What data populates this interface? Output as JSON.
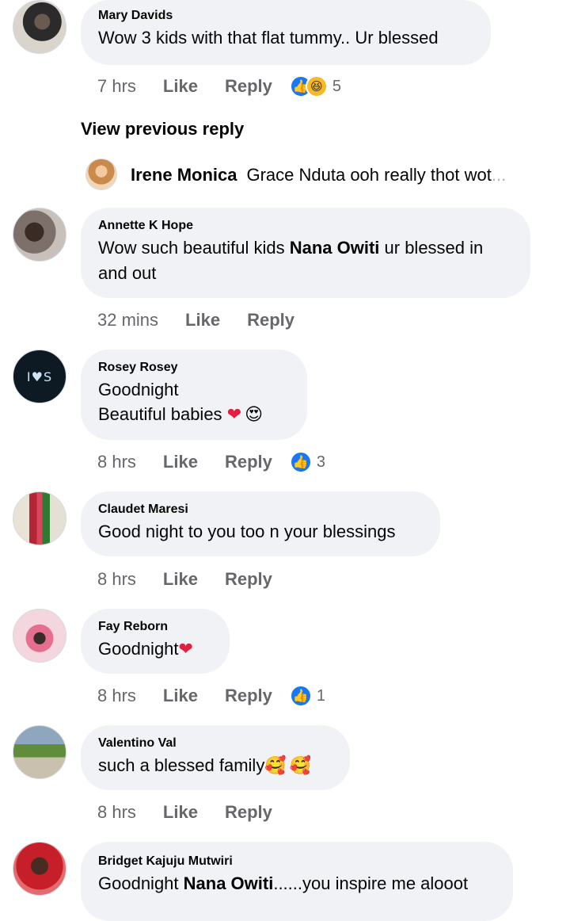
{
  "comments": [
    {
      "name": "Mary Davids",
      "text": "Wow 3 kids with that flat tummy.. Ur blessed",
      "time": "7 hrs",
      "like": "Like",
      "reply": "Reply",
      "reaction_count": "5",
      "reactions": [
        "like-icon",
        "haha-icon"
      ]
    },
    {
      "name": "Annette K Hope",
      "text_before": "Wow such beautiful kids ",
      "mention": "Nana Owiti",
      "text_after": " ur blessed in and out",
      "time": "32 mins",
      "like": "Like",
      "reply": "Reply"
    },
    {
      "name": "Rosey Rosey",
      "line1": "Goodnight",
      "line2": "Beautiful babies",
      "time": "8 hrs",
      "like": "Like",
      "reply": "Reply",
      "reaction_count": "3",
      "reactions": [
        "like-icon"
      ]
    },
    {
      "name": "Claudet Maresi",
      "text": "Good night to you too n your blessings",
      "time": "8 hrs",
      "like": "Like",
      "reply": "Reply"
    },
    {
      "name": "Fay Reborn",
      "text": "Goodnight",
      "time": "8 hrs",
      "like": "Like",
      "reply": "Reply",
      "reaction_count": "1",
      "reactions": [
        "like-icon"
      ]
    },
    {
      "name": "Valentino Val",
      "text": "such a blessed family",
      "time": "8 hrs",
      "like": "Like",
      "reply": "Reply"
    },
    {
      "name": "Bridget Kajuju Mutwiri",
      "text_before": "Goodnight ",
      "mention": "Nana Owiti",
      "text_after": "......you inspire me alooot"
    }
  ],
  "view_previous": "View previous reply",
  "reply_preview": {
    "name": "Irene Monica",
    "text": "Grace Nduta ooh really thot wot",
    "ellipsis": "..."
  },
  "avatar4_logo": "I♥S",
  "colors": {
    "bubble": "#f0f2f5",
    "meta_text": "#65676b",
    "like_blue": "#1877f2",
    "heart_red": "#e41e3f"
  }
}
